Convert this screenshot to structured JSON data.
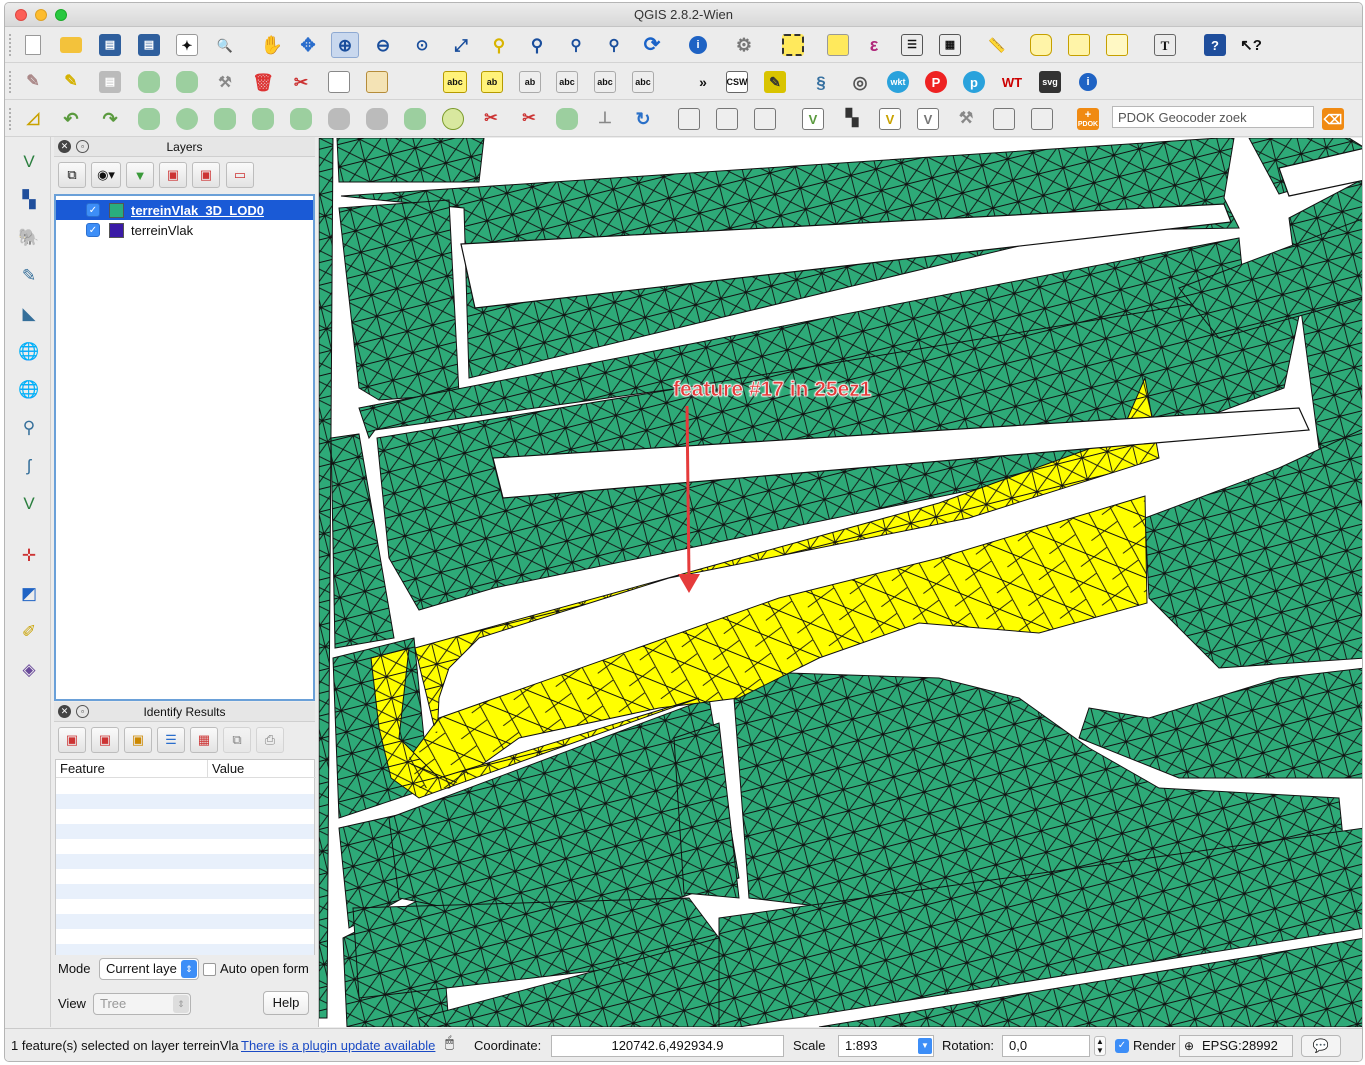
{
  "window": {
    "title": "QGIS 2.8.2-Wien"
  },
  "toolbar": {
    "search_placeholder": "PDOK Geocoder zoek",
    "pdok_label": "PDOK",
    "csw_label": "CSW",
    "wkt_label": "wkt",
    "svg_label": "svg"
  },
  "layers_panel": {
    "title": "Layers",
    "layers": [
      {
        "name": "terreinVlak_3D_LOD0",
        "checked": true,
        "color": "#2aae7d",
        "selected": true
      },
      {
        "name": "terreinVlak",
        "checked": true,
        "color": "#3a1aa6",
        "selected": false
      }
    ]
  },
  "identify_panel": {
    "title": "Identify Results",
    "col_feature": "Feature",
    "col_value": "Value",
    "mode_label": "Mode",
    "mode_value": "Current laye",
    "auto_open_label": "Auto open form",
    "view_label": "View",
    "view_value": "Tree",
    "help_label": "Help"
  },
  "map": {
    "annotation": "feature #17 in 25ez1",
    "fill_color": "#2eaa78",
    "selected_color": "#ffff00",
    "road_color": "#ffffff"
  },
  "status": {
    "message": "1 feature(s) selected on layer terreinVla",
    "plugin_link": "There is a plugin update available",
    "coord_label": "Coordinate:",
    "coord_value": "120742.6,492934.9",
    "scale_label": "Scale",
    "scale_value": "1:893",
    "rotation_label": "Rotation:",
    "rotation_value": "0,0",
    "render_label": "Render",
    "crs_value": "EPSG:28992"
  }
}
